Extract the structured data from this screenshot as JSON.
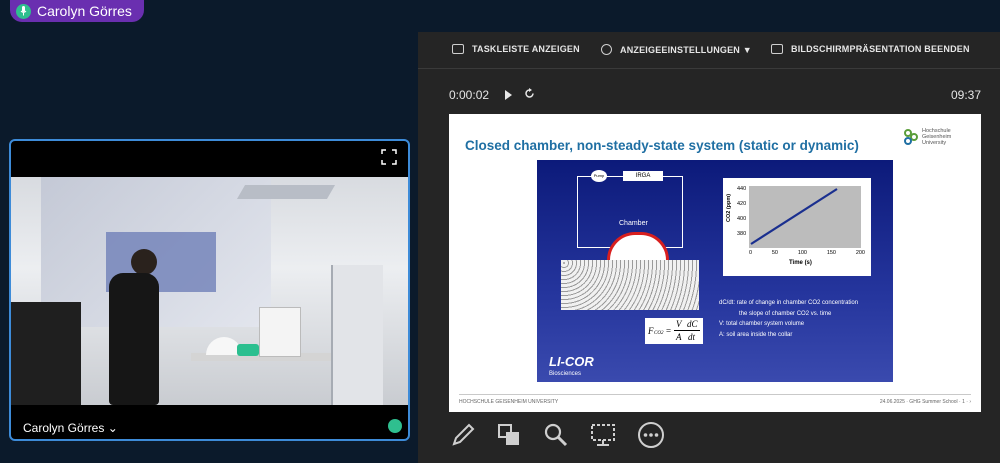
{
  "speaker": {
    "name": "Carolyn Görres",
    "icon": "microphone-icon"
  },
  "video": {
    "name": "Carolyn Görres",
    "dropdown_icon": "chevron-down-icon",
    "fullscreen_icon": "expand-icon",
    "mic_icon": "microphone-icon"
  },
  "toolbar": {
    "taskbar_label": "TASKLEISTE ANZEIGEN",
    "display_settings_label": "ANZEIGEEINSTELLUNGEN ▼",
    "end_presentation_label": "BILDSCHIRMPRÄSENTATION BEENDEN"
  },
  "timer": {
    "elapsed": "0:00:02",
    "clock": "09:37"
  },
  "slide": {
    "title": "Closed chamber, non-steady-state system (static or dynamic)",
    "logo_text": [
      "Hochschule",
      "Geisenheim",
      "University"
    ],
    "diagram": {
      "pump": "Pump",
      "irga": "IRGA",
      "chamber": "Chamber"
    },
    "formula": {
      "lhs": "F",
      "sub": "CO2",
      "eq": "=",
      "num_left": "V",
      "den_left": "A",
      "num_right": "dC",
      "den_right": "dt"
    },
    "legend": [
      "dC/dt: rate of change in chamber CO2 concentration",
      "the slope of chamber CO2 vs. time",
      "V: total chamber system volume",
      "A: soil area inside the collar"
    ],
    "brand": "LI-COR",
    "brand_sub": "Biosciences",
    "footer_left": "HOCHSCHULE GEISENHEIM UNIVERSITY",
    "footer_right": "24.06.2025 · GHG Summer School · 1 · ›",
    "chart": {
      "ylabel": "CO2 (ppm)",
      "xlabel": "Time (s)",
      "yticks": [
        "440",
        "420",
        "400",
        "380"
      ],
      "xticks": [
        "0",
        "50",
        "100",
        "150",
        "200"
      ]
    }
  },
  "tools": [
    "pen-icon",
    "layout-icon",
    "magnifier-icon",
    "screen-pointer-icon",
    "more-icon"
  ]
}
